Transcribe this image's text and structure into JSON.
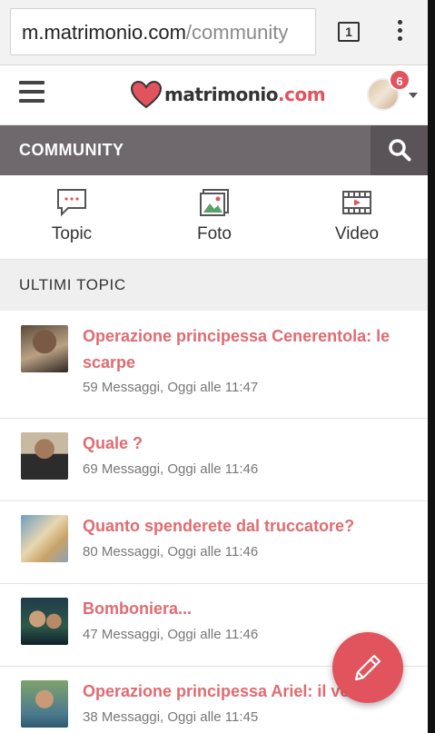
{
  "browser": {
    "url_host": "m.matrimonio.com",
    "url_path": "/community",
    "tab_count": "1"
  },
  "header": {
    "logo_text": "matrimonio",
    "logo_tld": ".com",
    "notification_count": "6"
  },
  "community": {
    "title": "COMMUNITY"
  },
  "categories": [
    {
      "label": "Topic",
      "icon": "chat-icon"
    },
    {
      "label": "Foto",
      "icon": "photo-icon"
    },
    {
      "label": "Video",
      "icon": "video-icon"
    }
  ],
  "section_title": "ULTIMI TOPIC",
  "topics": [
    {
      "title": "Operazione principessa Cenerentola: le scarpe",
      "meta": "59 Messaggi, Oggi alle 11:47"
    },
    {
      "title": "Quale ?",
      "meta": "69 Messaggi, Oggi alle 11:46"
    },
    {
      "title": "Quanto spenderete dal truccatore?",
      "meta": "80 Messaggi, Oggi alle 11:46"
    },
    {
      "title": "Bomboniera...",
      "meta": "47 Messaggi, Oggi alle 11:46"
    },
    {
      "title": "Operazione principessa Ariel: il vesti",
      "meta": "38 Messaggi, Oggi alle 11:45"
    }
  ],
  "colors": {
    "brand": "#e1535d",
    "topic_title": "#e06b70",
    "community_bar": "#6f686c"
  }
}
